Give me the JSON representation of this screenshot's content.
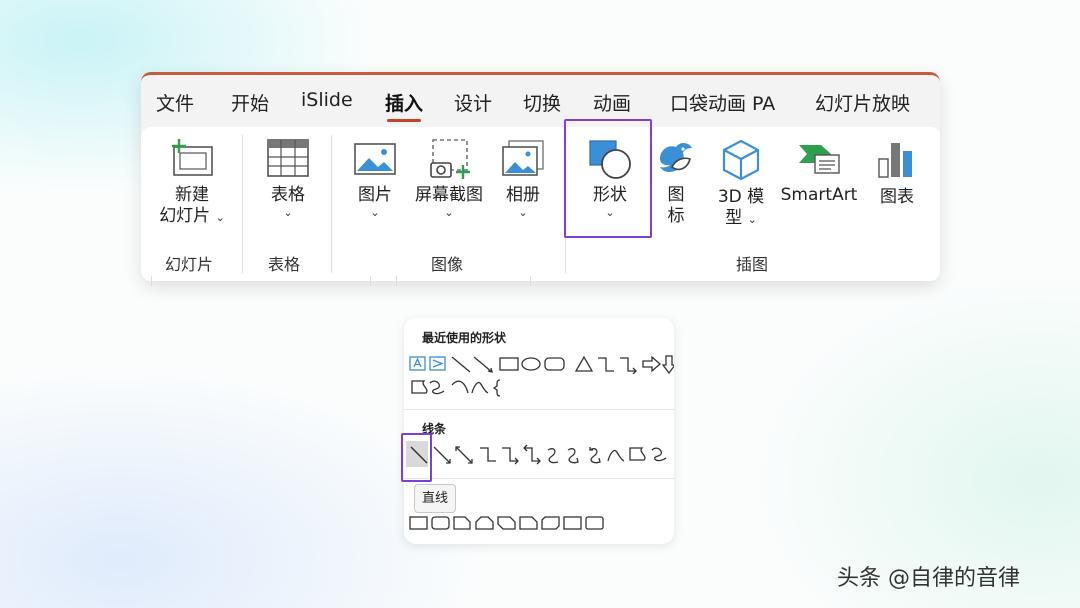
{
  "tabs": [
    "文件",
    "开始",
    "iSlide",
    "插入",
    "设计",
    "切换",
    "动画",
    "口袋动画 PA",
    "幻灯片放映"
  ],
  "active_tab": "插入",
  "groups": {
    "slides": "幻灯片",
    "tables": "表格",
    "images": "图像",
    "illustrations": "插图"
  },
  "commands": {
    "new_slide_1": "新建",
    "new_slide_2": "幻灯片",
    "table": "表格",
    "picture": "图片",
    "screenshot": "屏幕截图",
    "album": "相册",
    "shapes": "形状",
    "icons_1": "图",
    "icons_2": "标",
    "model3d_1": "3D 模",
    "model3d_2": "型",
    "smartart": "SmartArt",
    "chart": "图表",
    "chevron": "⌄"
  },
  "shapes_panel": {
    "recent_title": "最近使用的形状",
    "lines_title": "线条",
    "tooltip": "直线"
  },
  "watermark": "头条 @自律的音律",
  "colors": {
    "accent_tab": "#c4432a",
    "highlight": "#7d3fd6",
    "icon_blue": "#3b8fd6"
  }
}
